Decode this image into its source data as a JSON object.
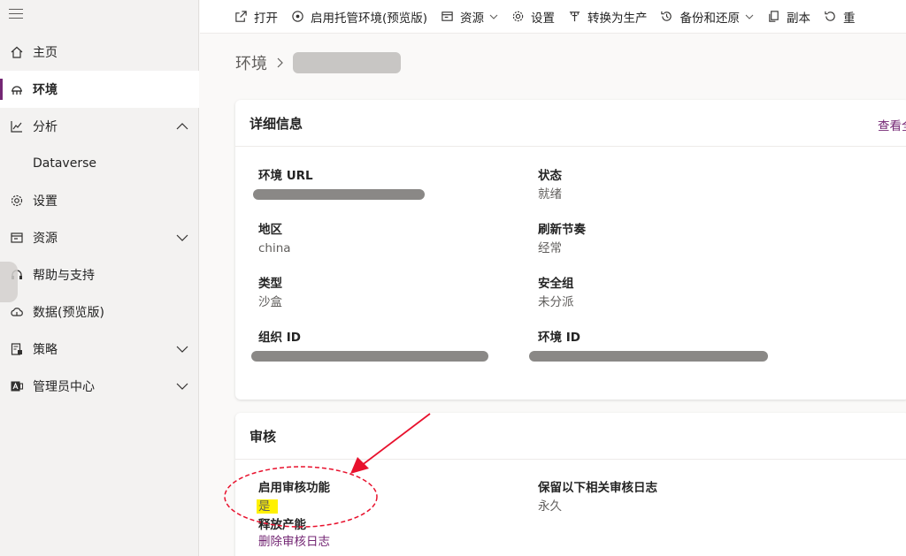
{
  "sidebar": {
    "items": [
      {
        "label": "主页",
        "icon": "home-icon"
      },
      {
        "label": "环境",
        "icon": "environment-icon",
        "active": true
      },
      {
        "label": "分析",
        "icon": "analytics-icon",
        "expanded": true
      },
      {
        "label": "Dataverse",
        "sub": true
      },
      {
        "label": "设置",
        "icon": "gear-icon"
      },
      {
        "label": "资源",
        "icon": "resources-icon",
        "expandable": true
      },
      {
        "label": "帮助与支持",
        "icon": "headset-icon"
      },
      {
        "label": "数据(预览版)",
        "icon": "cloud-data-icon"
      },
      {
        "label": "策略",
        "icon": "policy-icon",
        "expandable": true
      },
      {
        "label": "管理员中心",
        "icon": "admin-center-icon",
        "expandable": true
      }
    ]
  },
  "toolbar": {
    "open": "打开",
    "managed_env": "启用托管环境(预览版)",
    "resources": "资源",
    "settings": "设置",
    "convert": "转换为生产",
    "backup": "备份和还原",
    "copy": "副本",
    "reset": "重"
  },
  "breadcrumb": {
    "root": "环境"
  },
  "details": {
    "title": "详细信息",
    "view_all": "查看全部",
    "env_url_label": "环境 URL",
    "status_label": "状态",
    "status_value": "就绪",
    "region_label": "地区",
    "region_value": "china",
    "refresh_label": "刷新节奏",
    "refresh_value": "经常",
    "type_label": "类型",
    "type_value": "沙盒",
    "security_label": "安全组",
    "security_value": "未分派",
    "org_id_label": "组织 ID",
    "env_id_label": "环境 ID"
  },
  "audit": {
    "title": "审核",
    "enable_label": "启用审核功能",
    "enable_value": "是",
    "retain_label": "保留以下相关审核日志",
    "retain_value": "永久",
    "release_label": "释放产能",
    "delete_link": "删除审核日志"
  },
  "colors": {
    "accent": "#742774",
    "annotation": "#e8112d",
    "highlight": "#fff100"
  }
}
